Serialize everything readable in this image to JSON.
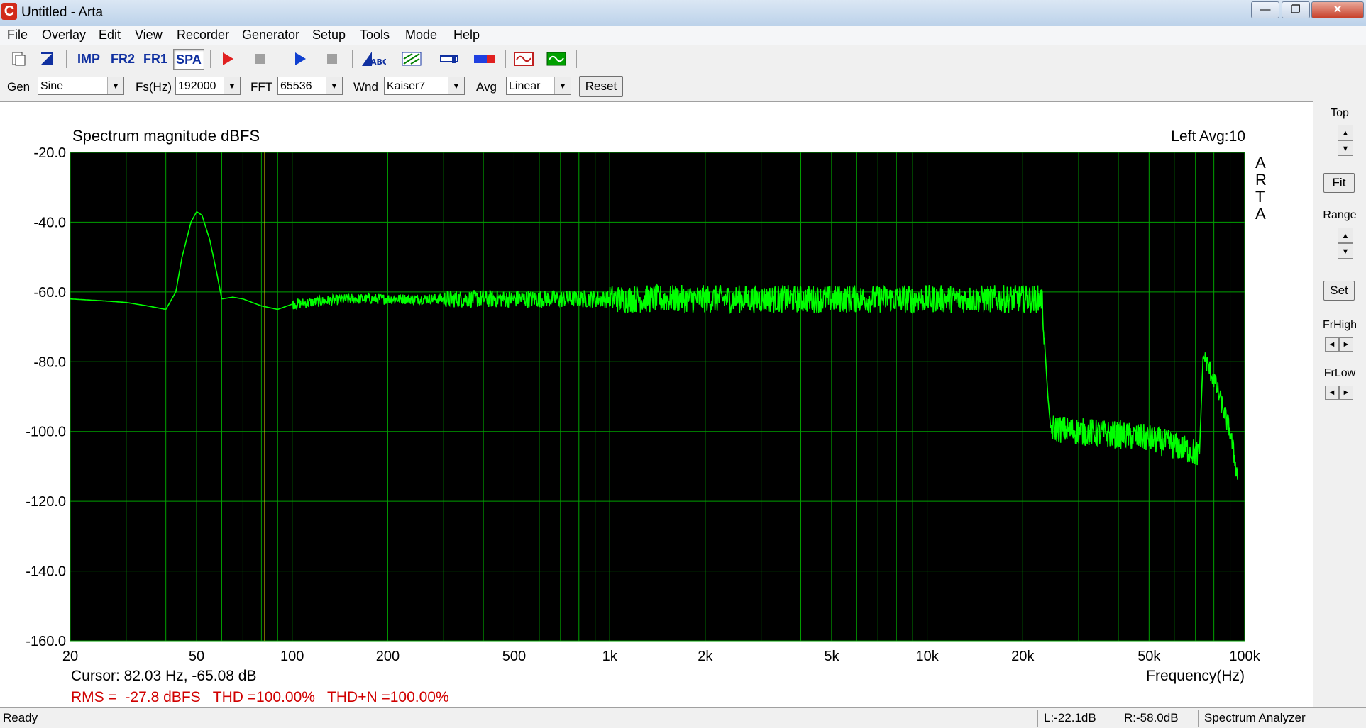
{
  "window": {
    "title": "Untitled - Arta",
    "app_icon_letter": "C",
    "minimize_glyph": "—",
    "maximize_glyph": "❐",
    "close_glyph": "✕"
  },
  "menu": [
    "File",
    "Overlay",
    "Edit",
    "View",
    "Recorder",
    "Generator",
    "Setup",
    "Tools",
    "Mode",
    "Help"
  ],
  "toolbar": {
    "imp": "IMP",
    "fr2": "FR2",
    "fr1": "FR1",
    "spa": "SPA",
    "abc": "ABC"
  },
  "controls": {
    "gen_label": "Gen",
    "gen_value": "Sine",
    "fs_label": "Fs(Hz)",
    "fs_value": "192000",
    "fft_label": "FFT",
    "fft_value": "65536",
    "wnd_label": "Wnd",
    "wnd_value": "Kaiser7",
    "avg_label": "Avg",
    "avg_value": "Linear",
    "reset_label": "Reset",
    "dropdown_glyph": "▼"
  },
  "right_panel": {
    "top_label": "Top",
    "fit_label": "Fit",
    "range_label": "Range",
    "set_label": "Set",
    "frhigh_label": "FrHigh",
    "frlow_label": "FrLow",
    "up_glyph": "▲",
    "down_glyph": "▼",
    "left_glyph": "◄",
    "right_glyph": "►"
  },
  "chart_data": {
    "type": "line",
    "title": "Spectrum magnitude dBFS",
    "channel_info": "Left  Avg:10",
    "side_label": [
      "A",
      "R",
      "T",
      "A"
    ],
    "xlabel": "Frequency(Hz)",
    "x_scale": "log",
    "xlim": [
      20,
      100000
    ],
    "ylim": [
      -160,
      -20
    ],
    "y_ticks": [
      -20,
      -40,
      -60,
      -80,
      -100,
      -120,
      -140,
      -160
    ],
    "y_tick_labels": [
      "-20.0",
      "-40.0",
      "-60.0",
      "-80.0",
      "-100.0",
      "-120.0",
      "-140.0",
      "-160.0"
    ],
    "x_ticks": [
      20,
      50,
      100,
      200,
      500,
      1000,
      2000,
      5000,
      10000,
      20000,
      50000,
      100000
    ],
    "x_tick_labels": [
      "20",
      "50",
      "100",
      "200",
      "500",
      "1k",
      "2k",
      "5k",
      "10k",
      "20k",
      "50k",
      "100k"
    ],
    "cursor_freq_hz": 82.03,
    "cursor_text": "Cursor: 82.03 Hz, -65.08 dB",
    "stats_text": "RMS =  -27.8 dBFS   THD =100.00%   THD+N =100.00%",
    "grid": true,
    "colors": {
      "background": "#000000",
      "trace": "#00ff00",
      "grid": "#00a000",
      "cursor": "#e0d000",
      "stats": "#d00000"
    },
    "series": [
      {
        "x": [
          20,
          25,
          30,
          35,
          40,
          43,
          45,
          48,
          50,
          52,
          55,
          58,
          60,
          65,
          70,
          80,
          90,
          100,
          150,
          200,
          300,
          500,
          1000,
          2000,
          5000,
          10000,
          20000,
          23000,
          24000,
          24500,
          30000,
          40000,
          50000,
          60000,
          70000,
          72000,
          74000,
          80000,
          90000,
          95000
        ],
        "y": [
          -62,
          -62.5,
          -63,
          -64,
          -65,
          -60,
          -50,
          -40,
          -37,
          -38,
          -45,
          -55,
          -62,
          -61.5,
          -62,
          -64,
          -65,
          -63.5,
          -62,
          -62,
          -62,
          -62,
          -62,
          -62,
          -62,
          -62,
          -62,
          -62,
          -90,
          -99,
          -100,
          -101,
          -102,
          -104,
          -106,
          -107,
          -78,
          -85,
          -100,
          -113
        ]
      }
    ]
  },
  "status": {
    "left": "Ready",
    "l_level": "L:-22.1dB",
    "r_level": "R:-58.0dB",
    "mode": "Spectrum Analyzer"
  }
}
